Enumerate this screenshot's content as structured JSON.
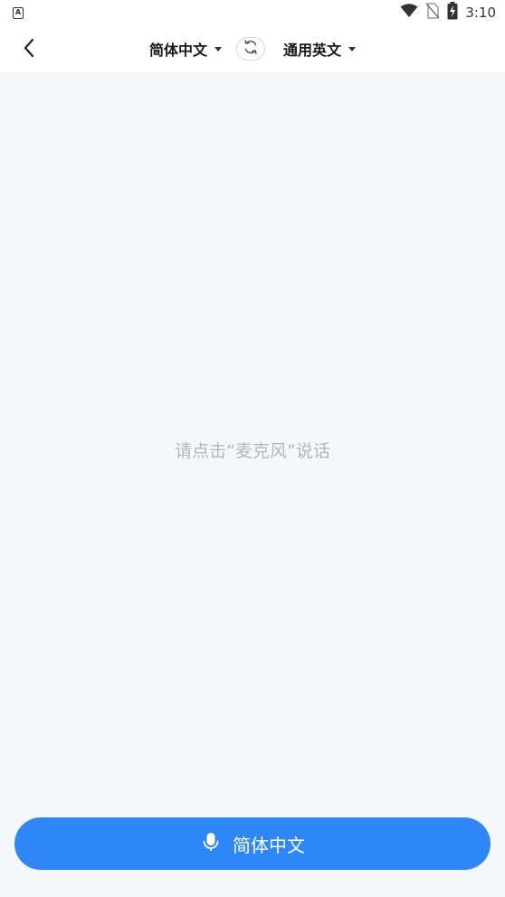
{
  "status_bar": {
    "notification_icon": "A",
    "time": "3:10",
    "icons": [
      "wifi-icon",
      "no-sim-icon",
      "battery-charging-icon"
    ]
  },
  "header": {
    "back_icon": "chevron-left-icon",
    "source_language": "简体中文",
    "target_language": "通用英文",
    "swap_icon": "swap-icon"
  },
  "main": {
    "hint": "请点击“麦克风”说话"
  },
  "mic_button": {
    "icon": "microphone-icon",
    "label": "简体中文"
  },
  "colors": {
    "accent": "#2f86f6",
    "background": "#f5f7fa",
    "hint_text": "#b3b6bb"
  }
}
